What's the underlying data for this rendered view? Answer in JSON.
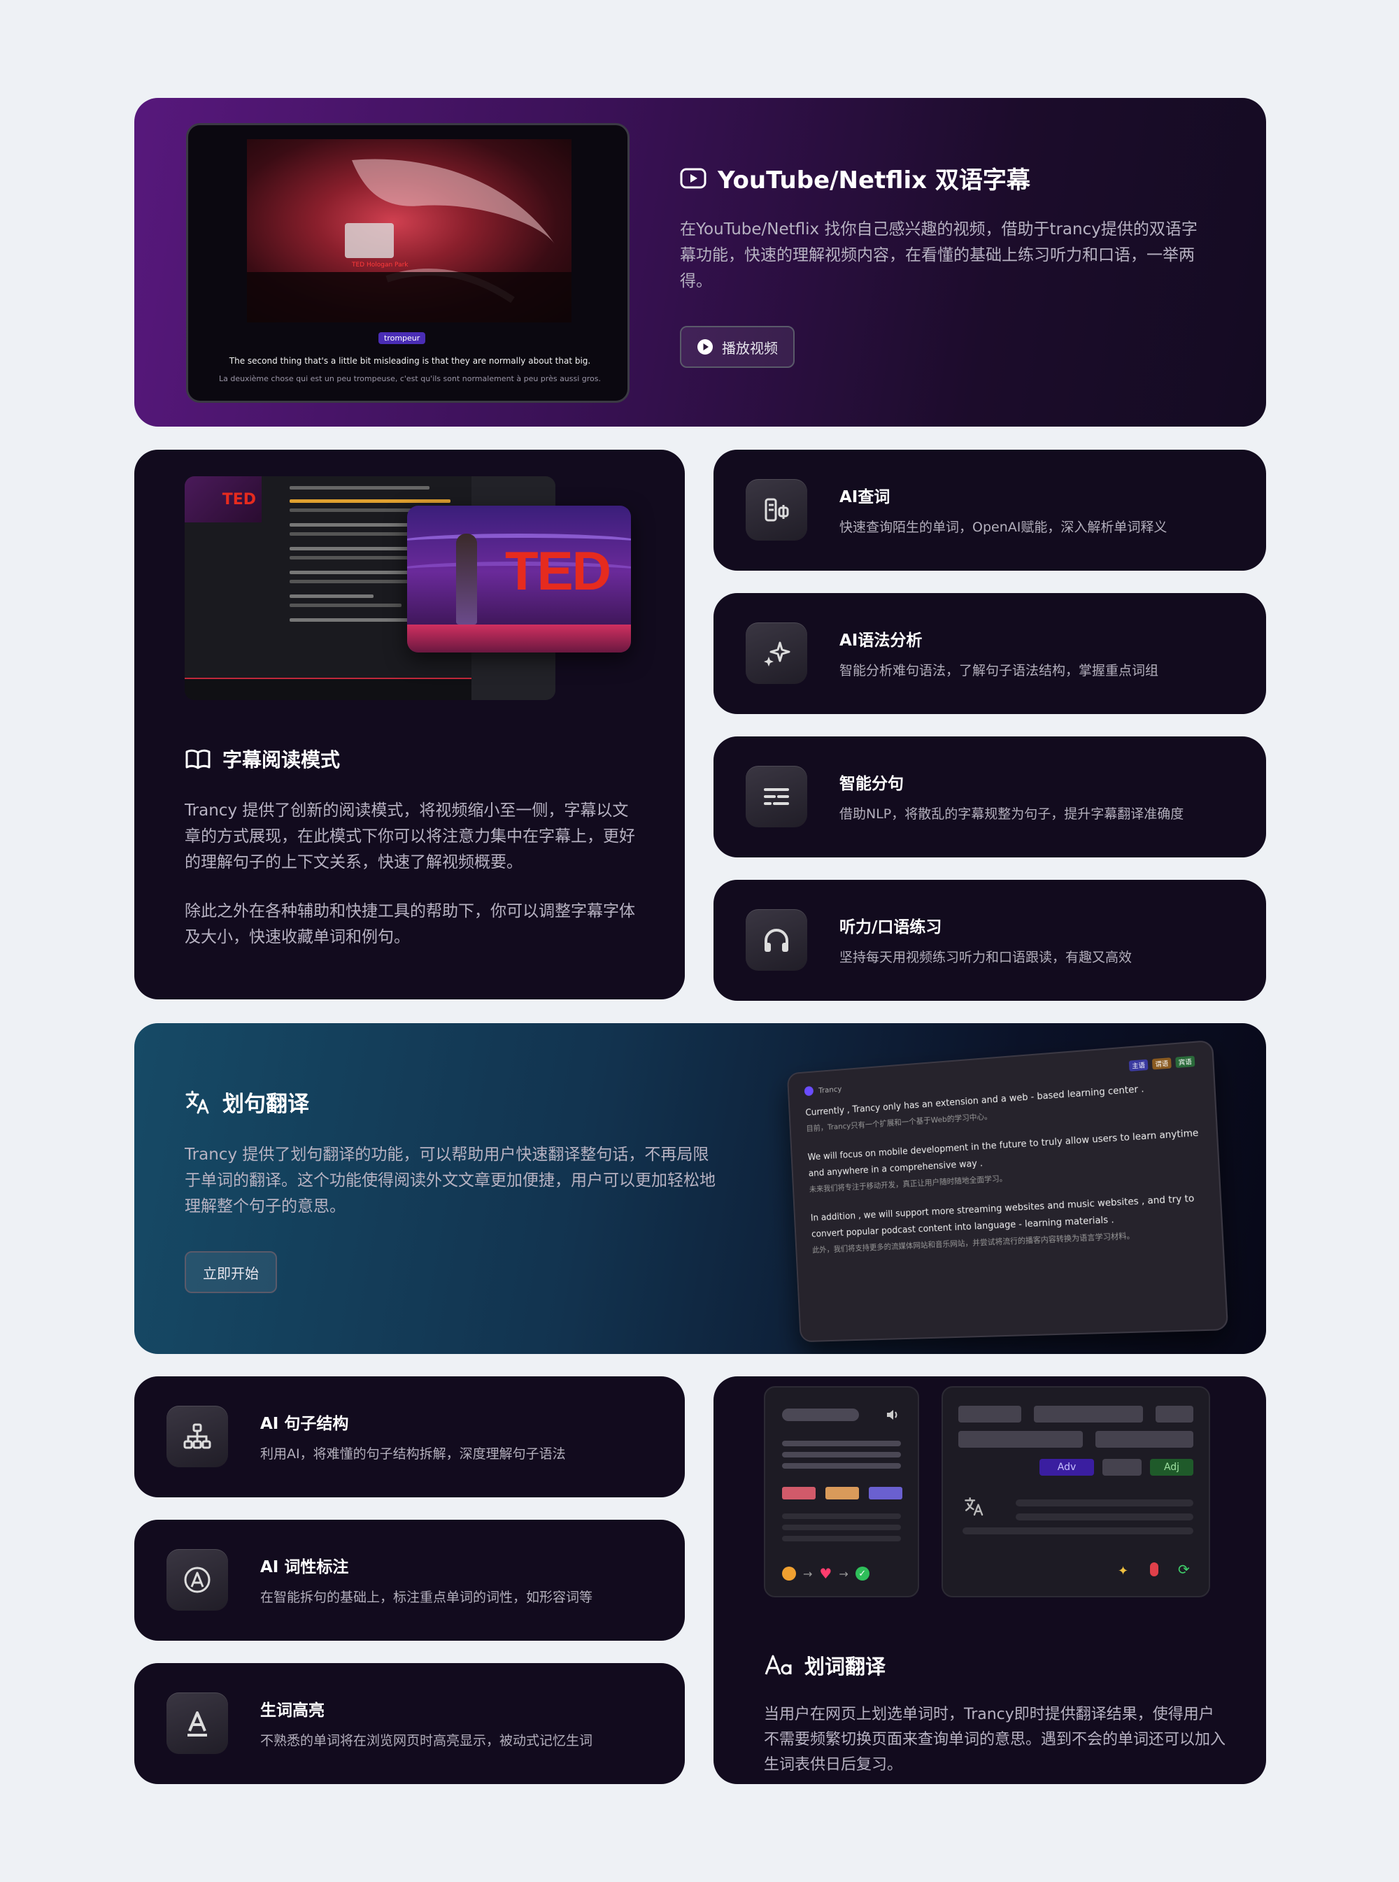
{
  "youtube": {
    "title": "YouTube/Netflix 双语字幕",
    "desc": "在YouTube/Netflix 找你自己感兴趣的视频，借助于trancy提供的双语字幕功能，快速的理解视频内容，在看懂的基础上练习听力和口语，一举两得。",
    "button": "播放视频",
    "video": {
      "tooltip_word": "trompeur",
      "subtitle_en": "The second thing that's a little bit misleading is that they are normally about that big.",
      "subtitle_fr": "La deuxième chose qui est un peu trompeuse, c'est qu'ils sont normalement à peu près aussi gros.",
      "stage_logo": "TED Hologan Park"
    }
  },
  "reading": {
    "title": "字幕阅读模式",
    "desc1": "Trancy 提供了创新的阅读模式，将视频缩小至一侧，字幕以文章的方式展现，在此模式下你可以将注意力集中在字幕上，更好的理解句子的上下文关系，快速了解视频概要。",
    "desc2": "除此之外在各种辅助和快捷工具的帮助下，你可以调整字幕字体及大小，快速收藏单词和例句。",
    "preview_logo": "TED"
  },
  "features_right": [
    {
      "title": "AI查词",
      "desc": "快速查询陌生的单词，OpenAI赋能，深入解析单词释义",
      "icon": "ai-lookup-icon"
    },
    {
      "title": "AI语法分析",
      "desc": "智能分析难句语法，了解句子语法结构，掌握重点词组",
      "icon": "sparkle-icon"
    },
    {
      "title": "智能分句",
      "desc": "借助NLP，将散乱的字幕规整为句子，提升字幕翻译准确度",
      "icon": "lines-icon"
    },
    {
      "title": "听力/口语练习",
      "desc": "坚持每天用视频练习听力和口语跟读，有趣又高效",
      "icon": "headphones-icon"
    }
  ],
  "sentence": {
    "title": "划句翻译",
    "desc": "Trancy 提供了划句翻译的功能，可以帮助用户快速翻译整句话，不再局限于单词的翻译。这个功能使得阅读外文文章更加便捷，用户可以更加轻松地理解整个句子的意思。",
    "button": "立即开始",
    "panel": {
      "brand": "Trancy",
      "lines": [
        {
          "en": "Currently , Trancy only has an extension and a web - based learning center .",
          "zh": "目前，Trancy只有一个扩展和一个基于Web的学习中心。"
        },
        {
          "en": "We will focus on mobile development in the future to truly allow users to learn anytime and anywhere in a comprehensive way .",
          "zh": "未来我们将专注于移动开发，真正让用户随时随地全面学习。"
        },
        {
          "en": "In addition , we will support more streaming websites and music websites , and try to convert popular podcast content into language - learning materials .",
          "zh": "此外，我们将支持更多的流媒体网站和音乐网站，并尝试将流行的播客内容转换为语言学习材料。"
        }
      ],
      "tags": {
        "subject": "主语",
        "predicate": "谓语",
        "object": "宾语"
      }
    }
  },
  "features_left": [
    {
      "title": "AI 句子结构",
      "desc": "利用AI，将难懂的句子结构拆解，深度理解句子语法",
      "icon": "hierarchy-icon"
    },
    {
      "title": "AI 词性标注",
      "desc": "在智能拆句的基础上，标注重点单词的词性，如形容词等",
      "icon": "at-a-icon"
    },
    {
      "title": "生词高亮",
      "desc": "不熟悉的单词将在浏览网页时高亮显示，被动式记忆生词",
      "icon": "letter-a-icon"
    }
  ],
  "word": {
    "title": "划词翻译",
    "desc": "当用户在网页上划选单词时，Trancy即时提供翻译结果，使得用户不需要频繁切换页面来查询单词的意思。遇到不会的单词还可以加入生词表供日后复习。",
    "tag_adv": "Adv",
    "tag_adj": "Adj"
  },
  "colors": {
    "page_bg": "#eef1f5",
    "card_bg": "#120b1e",
    "purple": "#5b1d82",
    "teal": "#144a66"
  }
}
